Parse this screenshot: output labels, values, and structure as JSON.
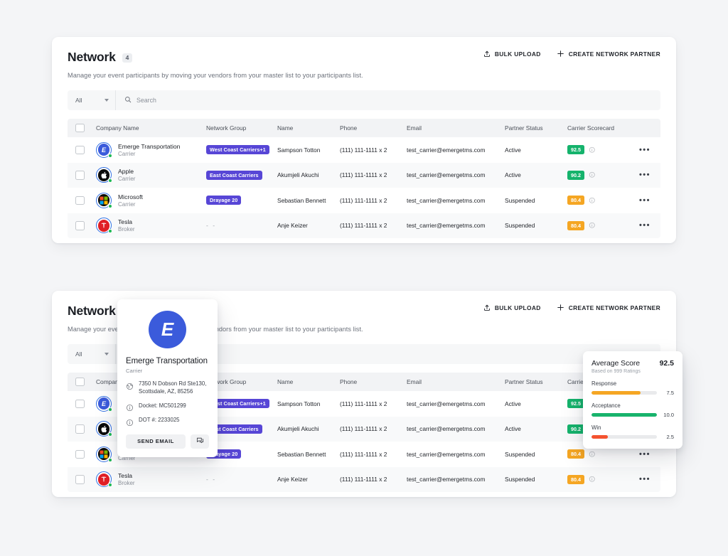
{
  "header": {
    "title": "Network",
    "count": "4",
    "subtitle": "Manage your event participants by moving your vendors from your master list to your participants list.",
    "bulk_upload_label": "BULK UPLOAD",
    "create_partner_label": "CREATE NETWORK PARTNER"
  },
  "filters": {
    "select_value": "All",
    "search_placeholder": "Search",
    "search_value": ""
  },
  "table": {
    "columns": {
      "company": "Company Name",
      "group": "Network Group",
      "name": "Name",
      "phone": "Phone",
      "email": "Email",
      "status": "Partner Status",
      "scorecard": "Carrier Scorecard"
    },
    "rows": [
      {
        "company": "Emerge Transportation",
        "type": "Carrier",
        "avatar_letter": "E",
        "avatar_kind": "av-emerge",
        "group": "West Coast Carriers+1",
        "name": "Sampson Totton",
        "phone": "(111) 111-1111 x 2",
        "email": "test_carrier@emergetms.com",
        "status": "Active",
        "score": "92.5",
        "score_color": "sc-green"
      },
      {
        "company": "Apple",
        "type": "Carrier",
        "avatar_letter": "",
        "avatar_kind": "av-apple",
        "group": "East Coast Carriers",
        "name": "Akumjeli Akuchi",
        "phone": "(111) 111-1111 x 2",
        "email": "test_carrier@emergetms.com",
        "status": "Active",
        "score": "90.2",
        "score_color": "sc-green"
      },
      {
        "company": "Microsoft",
        "type": "Carrier",
        "avatar_letter": "",
        "avatar_kind": "av-ms",
        "group": "Drayage 20",
        "name": "Sebastian Bennett",
        "phone": "(111) 111-1111 x 2",
        "email": "test_carrier@emergetms.com",
        "status": "Suspended",
        "score": "80.4",
        "score_color": "sc-amber"
      },
      {
        "company": "Tesla",
        "type": "Broker",
        "avatar_letter": "T",
        "avatar_kind": "av-tesla",
        "group": "",
        "group_empty": "- -",
        "name": "Anje Keizer",
        "phone": "(111) 111-1111 x 2",
        "email": "test_carrier@emergetms.com",
        "status": "Suspended",
        "score": "80.4",
        "score_color": "sc-amber"
      }
    ],
    "row_menu": "•••"
  },
  "company_popover": {
    "logo_letter": "E",
    "title": "Emerge Transportation",
    "subtitle": "Carrier",
    "address": "7350 N Dobson Rd Ste130, Scottsdale, AZ, 85256",
    "docket": "Docket: MC501299",
    "dot": "DOT #: 2233025",
    "send_email_label": "SEND EMAIL"
  },
  "score_popover": {
    "title": "Average Score",
    "value": "92.5",
    "subtitle": "Based on 999 Ratings",
    "metrics": [
      {
        "label": "Response",
        "value": "7.5",
        "pct": 75,
        "color": "#f5a623"
      },
      {
        "label": "Acceptance",
        "value": "10.0",
        "pct": 100,
        "color": "#18b36c"
      },
      {
        "label": "Win",
        "value": "2.5",
        "pct": 25,
        "color": "#f4522f"
      }
    ]
  },
  "chart_data": {
    "type": "bar",
    "title": "Average Score",
    "categories": [
      "Response",
      "Acceptance",
      "Win"
    ],
    "values": [
      7.5,
      10.0,
      2.5
    ],
    "ylim": [
      0,
      10
    ],
    "colors": [
      "#f5a623",
      "#18b36c",
      "#f4522f"
    ],
    "annotation": "Based on 999 Ratings",
    "overall": 92.5,
    "grid": false,
    "legend": "none",
    "xlabel": "",
    "ylabel": ""
  }
}
